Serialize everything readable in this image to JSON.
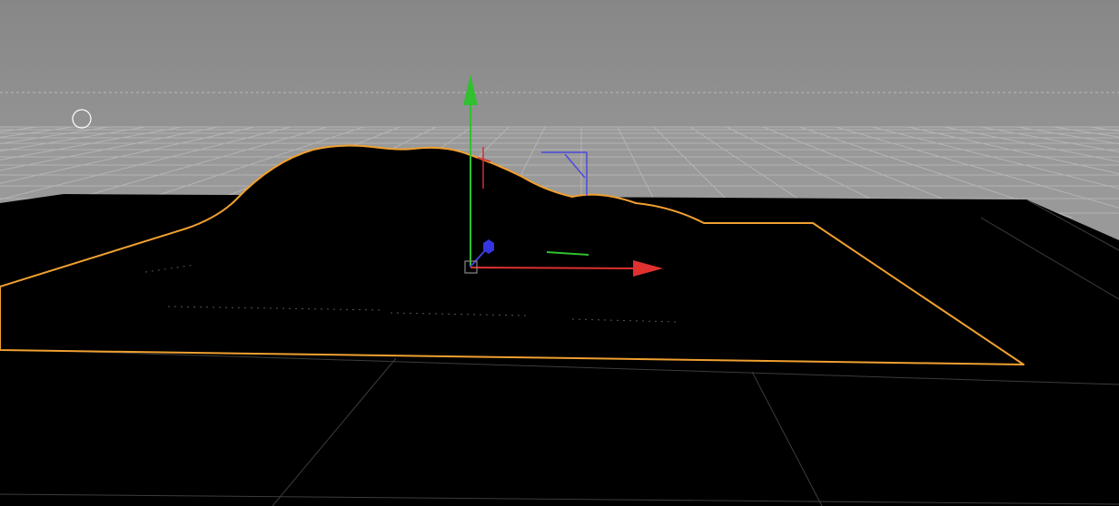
{
  "viewport": {
    "view_type": "3d-perspective",
    "colors": {
      "background_gradient_top": "#8a8a8a",
      "background_gradient_horizon": "#9a9a9a",
      "grid_line": "#b4b4b4",
      "horizon_dashed": "#bdbdbd",
      "terrain_fill": "#000000",
      "selection_outline": "#f0a030",
      "floor_grid_dark": "#3a3a3a",
      "gizmo_x": "#e03030",
      "gizmo_y": "#30c030",
      "gizmo_z": "#3030e0"
    },
    "objects": [
      {
        "name": "terrain-mesh",
        "selected": true
      }
    ],
    "gizmo": {
      "type": "move",
      "axes": [
        "X",
        "Y",
        "Z"
      ]
    },
    "icons": {
      "cursor": "circle-cursor-icon",
      "light": "spotlight-icon",
      "object_pivot": "pivot-icon"
    }
  }
}
